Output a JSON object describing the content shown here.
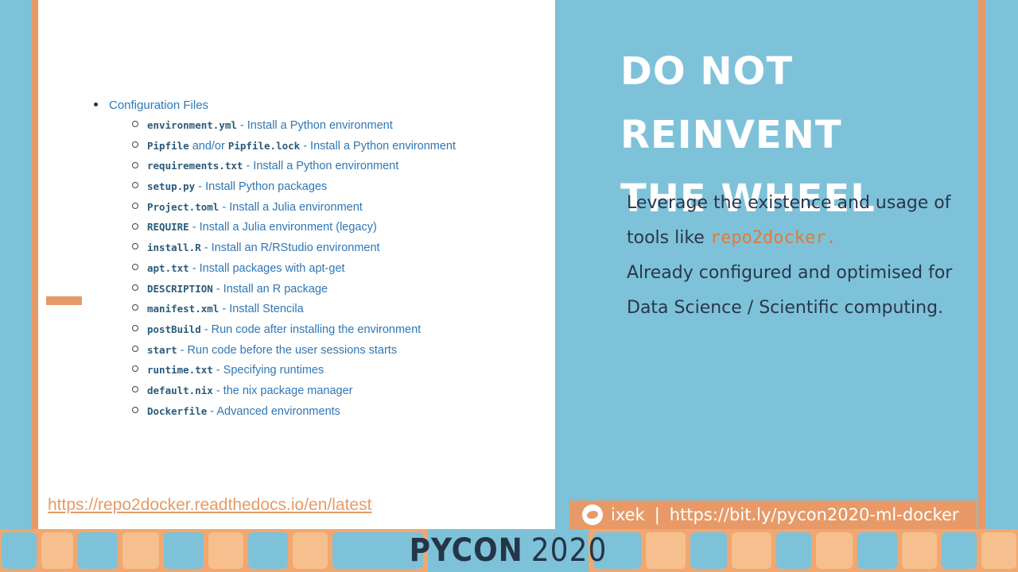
{
  "doc": {
    "section_title": "Configuration Files",
    "items": [
      {
        "code": "environment.yml",
        "desc": " - Install a Python environment"
      },
      {
        "code": "Pipfile",
        "mid": " and/or ",
        "code2": "Pipfile.lock",
        "desc": " - Install a Python environment"
      },
      {
        "code": "requirements.txt",
        "desc": " - Install a Python environment"
      },
      {
        "code": "setup.py",
        "desc": " - Install Python packages"
      },
      {
        "code": "Project.toml",
        "desc": " - Install a Julia environment"
      },
      {
        "code": "REQUIRE",
        "desc": " - Install a Julia environment (legacy)"
      },
      {
        "code": "install.R",
        "desc": " - Install an R/RStudio environment"
      },
      {
        "code": "apt.txt",
        "desc": " - Install packages with apt-get"
      },
      {
        "code": "DESCRIPTION",
        "desc": " - Install an R package"
      },
      {
        "code": "manifest.xml",
        "desc": " - Install Stencila"
      },
      {
        "code": "postBuild",
        "desc": " - Run code after installing the environment"
      },
      {
        "code": "start",
        "desc": " - Run code before the user sessions starts"
      },
      {
        "code": "runtime.txt",
        "desc": " - Specifying runtimes"
      },
      {
        "code": "default.nix",
        "desc": " - the nix package manager"
      },
      {
        "code": "Dockerfile",
        "desc": " - Advanced environments"
      }
    ],
    "link": "https://repo2docker.readthedocs.io/en/latest"
  },
  "panel": {
    "headline_line1": "DO NOT REINVENT",
    "headline_line2": "THE WHEEL",
    "body_pre": "Leverage the existence and usage of tools like ",
    "body_tool": "repo2docker.",
    "body_post": "Already configured and optimised for Data Science / Scientific computing.",
    "social_handle": "ixek",
    "social_sep": "|",
    "social_url": "https://bit.ly/pycon2020-ml-docker"
  },
  "banner": {
    "brand": "PYCON",
    "year": "2020"
  },
  "colors": {
    "accent_orange": "#e79a67",
    "panel_blue": "#7ec2d9",
    "link_blue": "#2f77b4",
    "dark_text": "#29364a"
  }
}
